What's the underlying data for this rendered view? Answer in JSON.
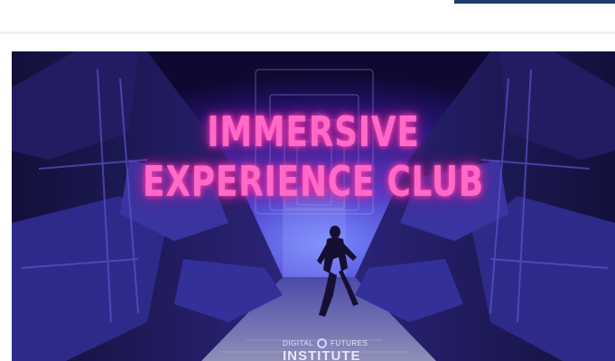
{
  "banner": {
    "title_line_1": "IMMERSIVE",
    "title_line_2": "EXPERIENCE CLUB",
    "logo": {
      "word_left": "DIGITAL",
      "word_right": "FUTURES",
      "word_bottom": "INSTITUTE"
    }
  },
  "colors": {
    "header_button": "#1f3a6e",
    "title_neon": "#ff69c8",
    "scene_base": "#150c3a"
  },
  "icons": {
    "logo_mark": "ring-icon"
  }
}
